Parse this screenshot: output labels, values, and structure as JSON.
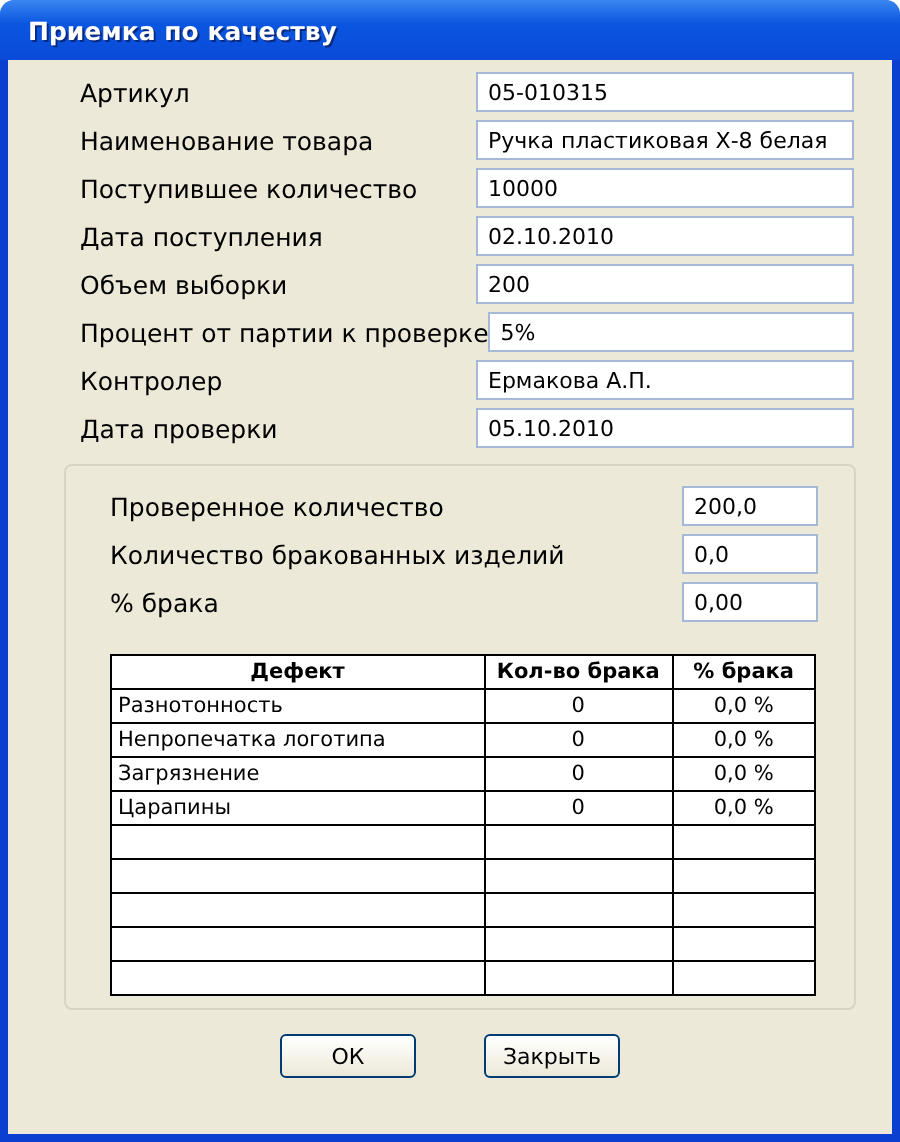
{
  "window": {
    "title": "Приемка по качеству"
  },
  "fields": [
    {
      "label": "Артикул",
      "value": "05-010315"
    },
    {
      "label": "Наименование товара",
      "value": "Ручка пластиковая Х-8 белая"
    },
    {
      "label": "Поступившее количество",
      "value": "10000"
    },
    {
      "label": "Дата поступления",
      "value": "02.10.2010"
    },
    {
      "label": "Объем выборки",
      "value": "200"
    },
    {
      "label": "Процент от партии к проверке",
      "value": "5%"
    },
    {
      "label": "Контролер",
      "value": "Ермакова А.П."
    },
    {
      "label": "Дата проверки",
      "value": "05.10.2010"
    }
  ],
  "summary": [
    {
      "label": "Проверенное количество",
      "value": "200,0"
    },
    {
      "label": "Количество бракованных изделий",
      "value": "0,0"
    },
    {
      "label": "% брака",
      "value": "0,00"
    }
  ],
  "table": {
    "columns": [
      "Дефект",
      "Кол-во брака",
      "% брака"
    ],
    "rows": [
      [
        "Разнотонность",
        "0",
        "0,0 %"
      ],
      [
        "Непропечатка логотипа",
        "0",
        "0,0 %"
      ],
      [
        "Загрязнение",
        "0",
        "0,0 %"
      ],
      [
        "Царапины",
        "0",
        "0,0 %"
      ]
    ]
  },
  "buttons": [
    "ОК",
    "Закрыть"
  ]
}
